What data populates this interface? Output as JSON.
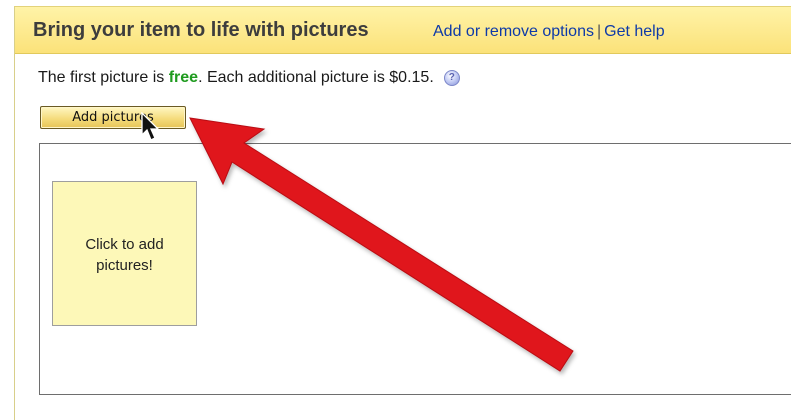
{
  "header": {
    "title": "Bring your item to life with pictures",
    "links": {
      "options": "Add or remove options",
      "separator": "|",
      "help": "Get help"
    }
  },
  "info": {
    "prefix": "The first picture is ",
    "free": "free",
    "suffix": ". Each additional picture is $0.15.",
    "help_icon": "?"
  },
  "add_button": {
    "label": "Add pictures"
  },
  "upload_area": {
    "tile_line1": "Click to add",
    "tile_line2": "pictures!"
  },
  "colors": {
    "header_bg": "#fbe27a",
    "link": "#0e3aa8",
    "free_text": "#1f9b1f",
    "tile_bg": "#fdf8b8",
    "arrow": "#e0141b"
  },
  "icons": {
    "help": "help-question-icon",
    "annotation": "red-arrow-annotation",
    "pointer": "mouse-pointer-icon"
  }
}
